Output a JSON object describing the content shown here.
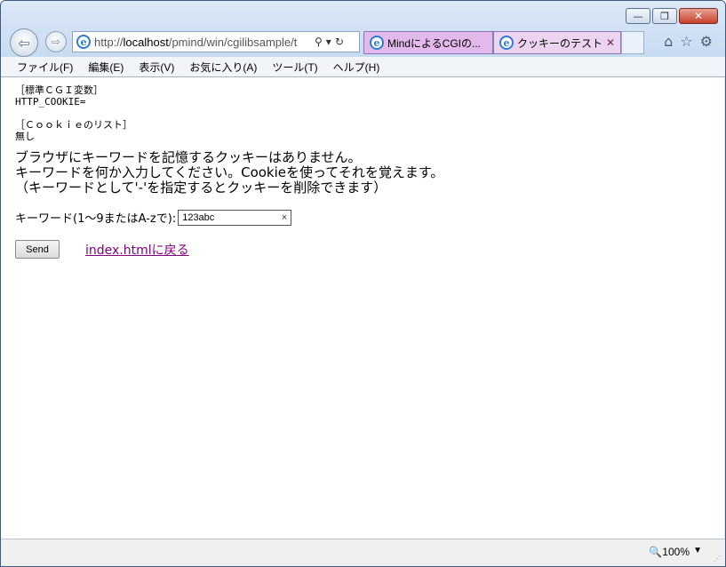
{
  "window": {
    "caption_minimize": "—",
    "caption_restore": "❐",
    "caption_close": "✕"
  },
  "address": {
    "url_prefix": "http://",
    "url_host": "localhost",
    "url_path": "/pmind/win/cgilibsample/t"
  },
  "tabs": [
    {
      "label": "MindによるCGIの..."
    },
    {
      "label": "クッキーのテスト",
      "close": "✕"
    }
  ],
  "menu": {
    "items": [
      {
        "label": "ファイル(F)"
      },
      {
        "label": "編集(E)"
      },
      {
        "label": "表示(V)"
      },
      {
        "label": "お気に入り(A)"
      },
      {
        "label": "ツール(T)"
      },
      {
        "label": "ヘルプ(H)"
      }
    ]
  },
  "content": {
    "cgi_heading": "［標準ＣＧＩ変数］",
    "cgi_var": "HTTP_COOKIE=",
    "cookie_heading": "［Ｃｏｏｋｉｅのリスト］",
    "cookie_none": "無し",
    "message_lines": [
      "ブラウザにキーワードを記憶するクッキーはありません。",
      "キーワードを何か入力してください。Cookieを使ってそれを覚えます。",
      "（キーワードとして'-'を指定するとクッキーを削除できます）"
    ],
    "keyword_label": "キーワード(1〜9またはA-zで):",
    "keyword_value": "123abc",
    "keyword_clear": "×",
    "send_label": "Send",
    "back_link": "index.htmlに戻る"
  },
  "status": {
    "zoom": "100%"
  }
}
